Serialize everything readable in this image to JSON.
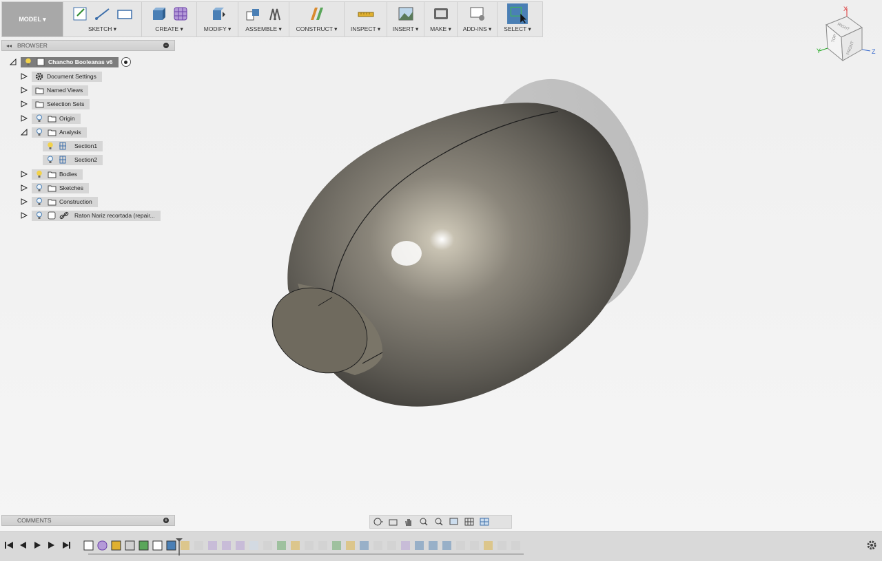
{
  "toolbar": {
    "workspace": "MODEL ▾",
    "groups": [
      {
        "label": "SKETCH ▾"
      },
      {
        "label": "CREATE ▾"
      },
      {
        "label": "MODIFY ▾"
      },
      {
        "label": "ASSEMBLE ▾"
      },
      {
        "label": "CONSTRUCT ▾"
      },
      {
        "label": "INSPECT ▾"
      },
      {
        "label": "INSERT ▾"
      },
      {
        "label": "MAKE ▾"
      },
      {
        "label": "ADD-INS ▾"
      },
      {
        "label": "SELECT ▾"
      }
    ]
  },
  "browser": {
    "title": "BROWSER",
    "root": "Chancho Booleanas v6",
    "items": [
      {
        "label": "Document Settings"
      },
      {
        "label": "Named Views"
      },
      {
        "label": "Selection Sets"
      },
      {
        "label": "Origin"
      },
      {
        "label": "Analysis"
      },
      {
        "label": "Section1"
      },
      {
        "label": "Section2"
      },
      {
        "label": "Bodies"
      },
      {
        "label": "Sketches"
      },
      {
        "label": "Construction"
      },
      {
        "label": "Raton Nariz recortada (repair..."
      }
    ]
  },
  "comments": {
    "title": "COMMENTS"
  },
  "viewcube": {
    "top": "TOP",
    "front": "FRONT",
    "right": "RIGHT",
    "x": "X",
    "y": "Y",
    "z": "Z"
  },
  "colors": {
    "accent": "#4a7fb5",
    "body": "#6d6a60",
    "model_btn": "#a8a8a8"
  }
}
